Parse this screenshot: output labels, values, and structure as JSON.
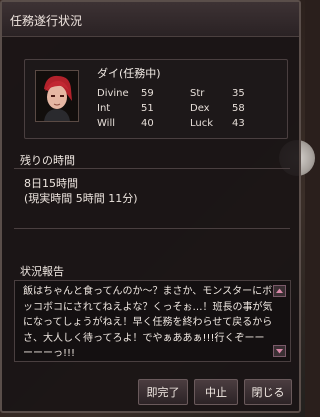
{
  "window": {
    "title": "任務遂行状況"
  },
  "character": {
    "name": "ダイ(任務中)",
    "stats": [
      {
        "label": "Divine",
        "value": "59"
      },
      {
        "label": "Str",
        "value": "35"
      },
      {
        "label": "Int",
        "value": "51"
      },
      {
        "label": "Dex",
        "value": "58"
      },
      {
        "label": "Will",
        "value": "40"
      },
      {
        "label": "Luck",
        "value": "43"
      }
    ]
  },
  "time": {
    "label": "残りの時間",
    "remaining": "8日15時間",
    "real": "(現実時間 5時間 11分)"
  },
  "report": {
    "label": "状況報告",
    "text": "飯はちゃんと食ってんのか～？まさか、モンスターにボッコボコにされてねえよな？くっそぉ…！班長の事が気になってしょうがねえ！早く任務を終わらせて戻るからさ、大人しく待ってろよ！でやぁああぁ!!!行くぞーーーーーっ!!!"
  },
  "buttons": {
    "complete": "即完了",
    "abort": "中止",
    "close": "閉じる"
  }
}
